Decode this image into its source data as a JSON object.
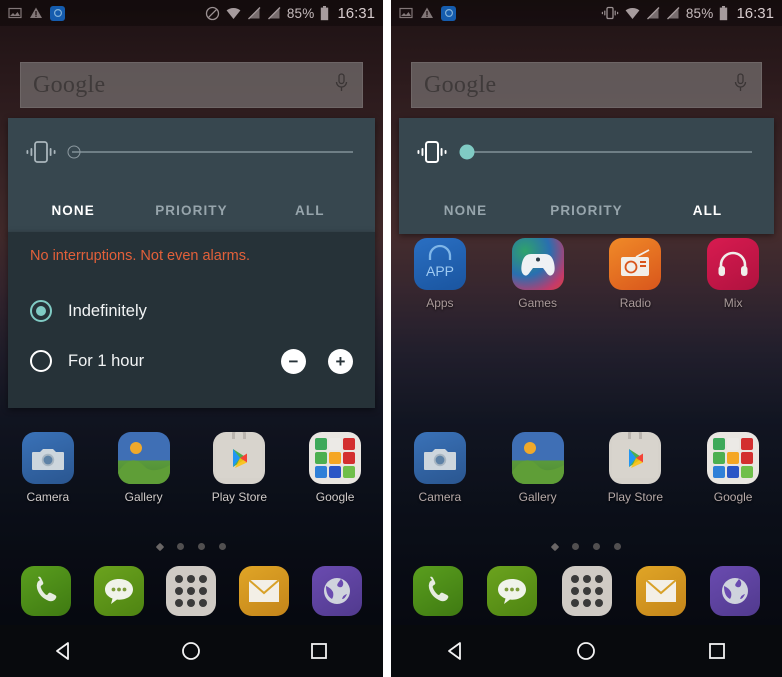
{
  "screens": [
    {
      "id": "left",
      "status_bar": {
        "left_icons": [
          "screenshot-icon",
          "warning-icon",
          "app-notification-icon"
        ],
        "right_icons": [
          "do-not-disturb-icon",
          "wifi-icon",
          "signal-off-icon",
          "signal-off-2-icon"
        ],
        "battery_percent": "85%",
        "battery_icon": "battery-icon",
        "time": "16:31"
      },
      "search_widget": {
        "label": "Google",
        "mic_icon": "microphone-icon"
      },
      "zen_panel": {
        "ringer_icon": "vibrate-icon",
        "slider_value": 0,
        "slider_thumb_color": "#8d9aa1",
        "tabs": [
          {
            "label": "NONE",
            "active": true
          },
          {
            "label": "PRIORITY",
            "active": false
          },
          {
            "label": "ALL",
            "active": false
          }
        ]
      },
      "zen_detail": {
        "visible": true,
        "warning": "No interruptions. Not even alarms.",
        "warning_color": "#e2603a",
        "options": [
          {
            "label": "Indefinitely",
            "selected": true,
            "has_steppers": false
          },
          {
            "label": "For 1 hour",
            "selected": false,
            "has_steppers": true
          }
        ],
        "minus_label": "−",
        "plus_label": "+"
      },
      "shortcut_row": {
        "visible": false,
        "apps": []
      },
      "main_row": {
        "apps": [
          {
            "label": "Camera",
            "icon": "camera-icon"
          },
          {
            "label": "Gallery",
            "icon": "gallery-icon"
          },
          {
            "label": "Play Store",
            "icon": "play-store-icon"
          },
          {
            "label": "Google",
            "icon": "google-folder-icon"
          }
        ]
      },
      "page_dots": {
        "count": 4,
        "current": 0
      },
      "dock": [
        {
          "label": "Phone",
          "icon": "phone-icon"
        },
        {
          "label": "Messages",
          "icon": "message-icon"
        },
        {
          "label": "Apps",
          "icon": "app-drawer-icon"
        },
        {
          "label": "Email",
          "icon": "mail-icon"
        },
        {
          "label": "Browser",
          "icon": "browser-icon"
        }
      ],
      "nav_bar": [
        {
          "label": "Back",
          "icon": "back-triangle-icon"
        },
        {
          "label": "Home",
          "icon": "home-circle-icon"
        },
        {
          "label": "Recents",
          "icon": "recents-square-icon"
        }
      ]
    },
    {
      "id": "right",
      "status_bar": {
        "left_icons": [
          "screenshot-icon",
          "warning-icon",
          "app-notification-icon"
        ],
        "right_icons": [
          "vibrate-icon",
          "wifi-icon",
          "signal-off-icon",
          "signal-off-2-icon"
        ],
        "battery_percent": "85%",
        "battery_icon": "battery-icon",
        "time": "16:31"
      },
      "search_widget": {
        "label": "Google",
        "mic_icon": "microphone-icon"
      },
      "zen_panel": {
        "ringer_icon": "vibrate-icon",
        "slider_value": 0,
        "slider_thumb_color": "#80cbc4",
        "tabs": [
          {
            "label": "NONE",
            "active": false
          },
          {
            "label": "PRIORITY",
            "active": false
          },
          {
            "label": "ALL",
            "active": true
          }
        ]
      },
      "zen_detail": {
        "visible": false,
        "warning": "",
        "options": []
      },
      "shortcut_row": {
        "visible": true,
        "apps": [
          {
            "label": "Apps",
            "icon": "apps-folder-icon"
          },
          {
            "label": "Games",
            "icon": "gamepad-icon"
          },
          {
            "label": "Radio",
            "icon": "radio-icon"
          },
          {
            "label": "Mix",
            "icon": "headphones-icon"
          }
        ]
      },
      "main_row": {
        "apps": [
          {
            "label": "Camera",
            "icon": "camera-icon"
          },
          {
            "label": "Gallery",
            "icon": "gallery-icon"
          },
          {
            "label": "Play Store",
            "icon": "play-store-icon"
          },
          {
            "label": "Google",
            "icon": "google-folder-icon"
          }
        ]
      },
      "page_dots": {
        "count": 4,
        "current": 0
      },
      "dock": [
        {
          "label": "Phone",
          "icon": "phone-icon"
        },
        {
          "label": "Messages",
          "icon": "message-icon"
        },
        {
          "label": "Apps",
          "icon": "app-drawer-icon"
        },
        {
          "label": "Email",
          "icon": "mail-icon"
        },
        {
          "label": "Browser",
          "icon": "browser-icon"
        }
      ],
      "nav_bar": [
        {
          "label": "Back",
          "icon": "back-triangle-icon"
        },
        {
          "label": "Home",
          "icon": "home-circle-icon"
        },
        {
          "label": "Recents",
          "icon": "recents-square-icon"
        }
      ]
    }
  ],
  "colors": {
    "zen_panel_bg": "#37474f",
    "zen_detail_bg": "#263238",
    "accent_teal": "#80cbc4",
    "warning_orange": "#e2603a",
    "navbar_bg": "#080a0d"
  }
}
